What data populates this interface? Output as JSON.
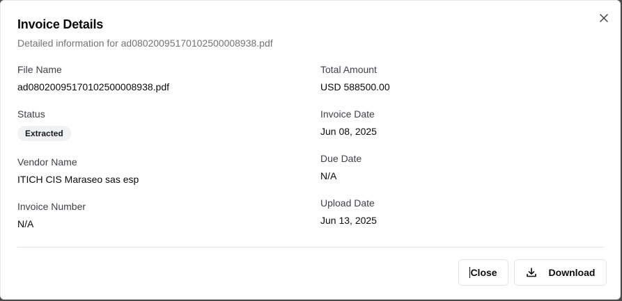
{
  "dialog": {
    "title": "Invoice Details",
    "subtitle": "Detailed information for ad0802009517010250000893​8.pdf"
  },
  "fields_left": {
    "file_name": {
      "label": "File Name",
      "value": "ad080200951701025000089​38.pdf"
    },
    "status": {
      "label": "Status",
      "value": "Extracted"
    },
    "vendor_name": {
      "label": "Vendor Name",
      "value": "ITICH CIS Maraseo sas esp"
    },
    "invoice_number": {
      "label": "Invoice Number",
      "value": "N/A"
    }
  },
  "fields_right": {
    "total_amount": {
      "label": "Total Amount",
      "value": "USD 588500.00"
    },
    "invoice_date": {
      "label": "Invoice Date",
      "value": "Jun 08, 2025"
    },
    "due_date": {
      "label": "Due Date",
      "value": "N/A"
    },
    "upload_date": {
      "label": "Upload Date",
      "value": "Jun 13, 2025"
    }
  },
  "footer": {
    "close_label": "Close",
    "download_label": "Download"
  },
  "icons": {
    "close": "close-icon",
    "download": "download-icon"
  },
  "colors": {
    "badge_bg": "#f1f2f4",
    "muted_text": "#737373",
    "border": "#e4e4e7"
  }
}
